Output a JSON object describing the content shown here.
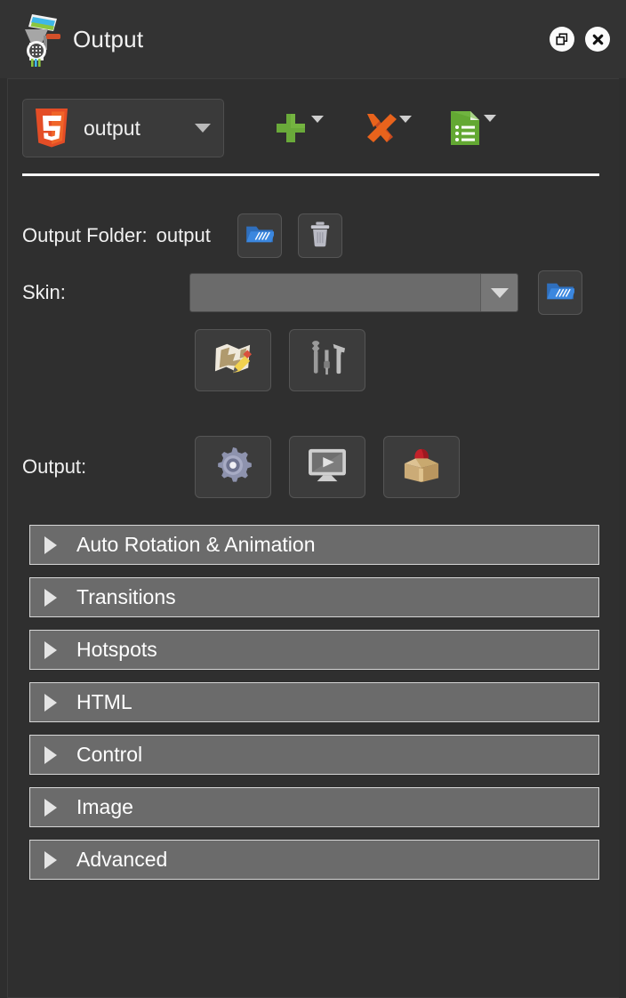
{
  "window": {
    "title": "Output",
    "logo_icon": "pano2vr-grinder-icon",
    "actions": [
      {
        "name": "restore-window-button",
        "icon": "restore-windows-icon"
      },
      {
        "name": "close-window-button",
        "icon": "close-x-icon"
      }
    ]
  },
  "toolbar": {
    "format_button": {
      "icon": "html5-logo-icon",
      "label": "output",
      "caret": "chevron-down-icon"
    },
    "add_button": {
      "icon": "plus-icon",
      "caret": "chevron-down-icon"
    },
    "remove_button": {
      "icon": "cross-x-icon",
      "caret": "chevron-down-icon"
    },
    "list_button": {
      "icon": "document-list-icon",
      "caret": "chevron-down-icon"
    }
  },
  "fields": {
    "output_folder": {
      "label": "Output Folder:",
      "value": "output",
      "browse_icon": "open-folder-icon",
      "delete_icon": "trash-can-icon"
    },
    "skin": {
      "label": "Skin:",
      "value": "",
      "dropdown_icon": "chevron-down-icon",
      "browse_icon": "open-folder-icon",
      "edit_skin_icon": "map-pencil-edit-icon",
      "skin_tools_icon": "wrench-screwdriver-hammer-icon"
    },
    "output": {
      "label": "Output:",
      "settings_icon": "gear-icon",
      "preview_icon": "monitor-play-icon",
      "package_icon": "gnome-in-box-icon"
    }
  },
  "sections": [
    {
      "label": "Auto Rotation & Animation",
      "expanded": false
    },
    {
      "label": "Transitions",
      "expanded": false
    },
    {
      "label": "Hotspots",
      "expanded": false
    },
    {
      "label": "HTML",
      "expanded": false
    },
    {
      "label": "Control",
      "expanded": false
    },
    {
      "label": "Image",
      "expanded": false
    },
    {
      "label": "Advanced",
      "expanded": false
    }
  ],
  "colors": {
    "window_bg": "#2e2e2e",
    "titlebar_bg": "#333333",
    "panel_bg": "#2f2f2f",
    "section_bg": "#6b6b6b",
    "section_border": "#d6d6d6",
    "text": "#f0f0f0",
    "divider": "#f7f7f7",
    "html5_orange": "#e44d26",
    "plus_green": "#6aaa3a",
    "cross_orange": "#e8631c",
    "list_green": "#63a833",
    "folder_blue": "#3b87df"
  }
}
